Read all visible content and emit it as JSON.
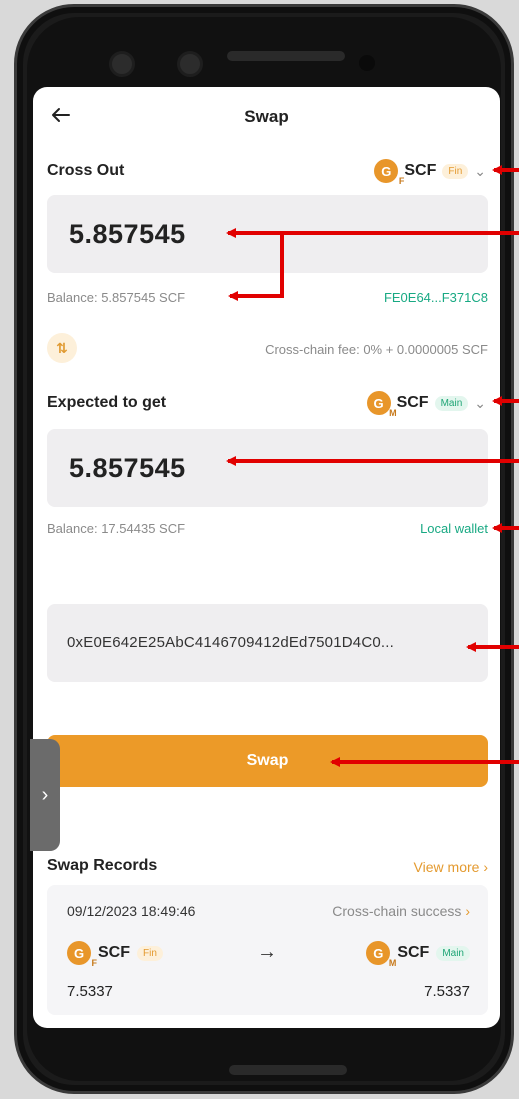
{
  "header": {
    "title": "Swap",
    "back_icon": "arrow-left-icon"
  },
  "cross_out": {
    "label": "Cross Out",
    "token": "SCF",
    "token_tag": "Fin",
    "amount": "5.857545",
    "balance": "Balance: 5.857545 SCF",
    "address_short": "FE0E64...F371C8"
  },
  "fee": {
    "text": "Cross-chain fee: 0% + 0.0000005 SCF",
    "swap_direction_icon": "swap-vertical-icon"
  },
  "expected": {
    "label": "Expected to get",
    "token": "SCF",
    "token_tag": "Main",
    "amount": "5.857545",
    "balance": "Balance: 17.54435 SCF",
    "wallet_link": "Local wallet"
  },
  "receive_address": "0xE0E642E25AbC4146709412dEd7501D4C0...",
  "swap_button": "Swap",
  "side_tab_icon": "chevron-right-icon",
  "records": {
    "title": "Swap Records",
    "view_more": "View more",
    "items": [
      {
        "time": "09/12/2023 18:49:46",
        "status": "Cross-chain success",
        "from_token": "SCF",
        "from_tag": "Fin",
        "to_token": "SCF",
        "to_tag": "Main",
        "from_amount": "7.5337",
        "to_amount": "7.5337"
      }
    ]
  },
  "colors": {
    "accent": "#ec9a28",
    "teal": "#18a983",
    "annotation_arrow": "#e10000"
  }
}
